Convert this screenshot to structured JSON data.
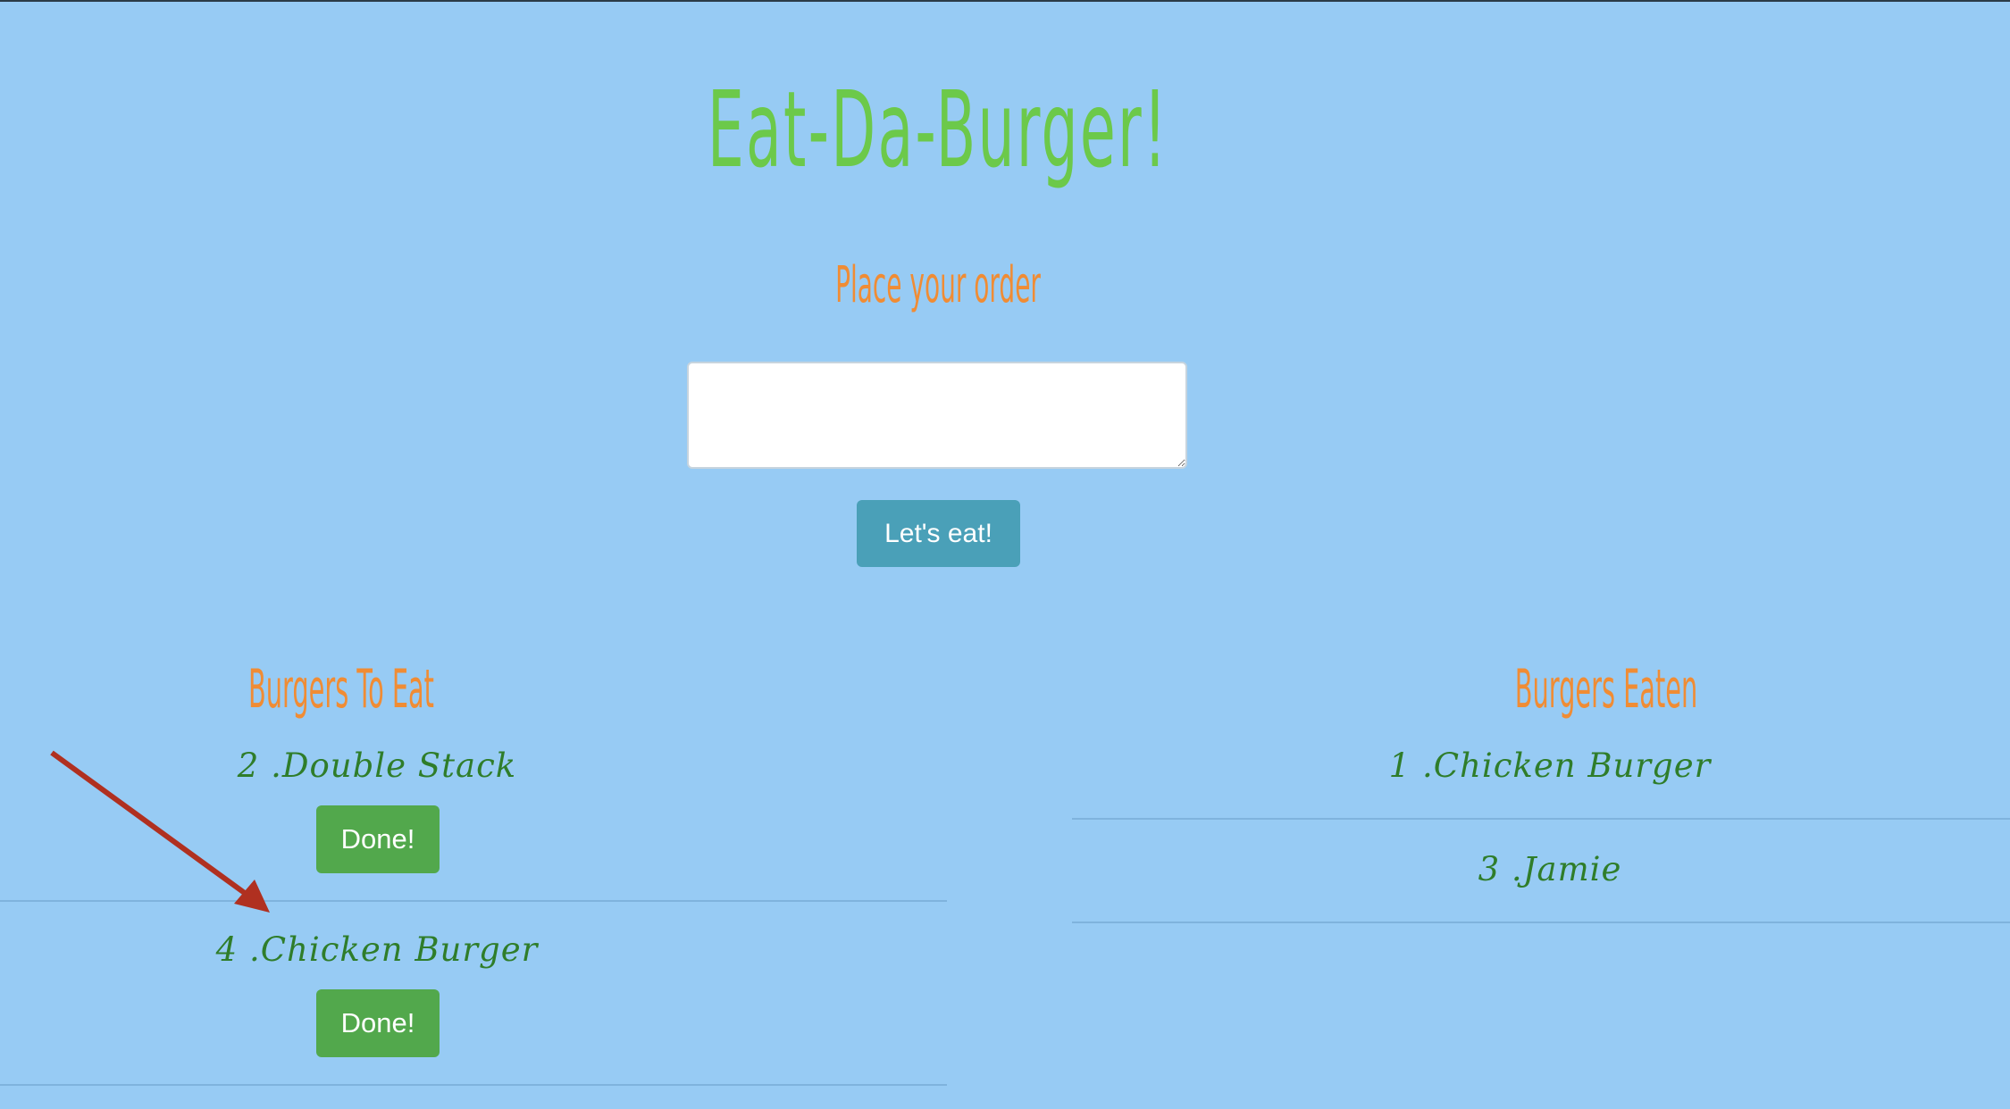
{
  "header": {
    "title": "Eat-Da-Burger!",
    "subtitle": "Place your order"
  },
  "order_form": {
    "input_value": "",
    "submit_label": "Let's eat!"
  },
  "to_eat": {
    "heading": "Burgers To Eat",
    "items": [
      {
        "label": "2 .Double Stack",
        "button": "Done!"
      },
      {
        "label": "4 .Chicken Burger",
        "button": "Done!"
      }
    ]
  },
  "eaten": {
    "heading": "Burgers Eaten",
    "items": [
      {
        "label": "1 .Chicken Burger"
      },
      {
        "label": "3 .Jamie"
      }
    ]
  },
  "colors": {
    "background": "#97cbf4",
    "title": "#6cc94a",
    "heading": "#f08c34",
    "item_text": "#2f7d2a",
    "submit_button": "#4aa0b8",
    "done_button": "#52a84c",
    "annotation_arrow": "#b03020"
  }
}
